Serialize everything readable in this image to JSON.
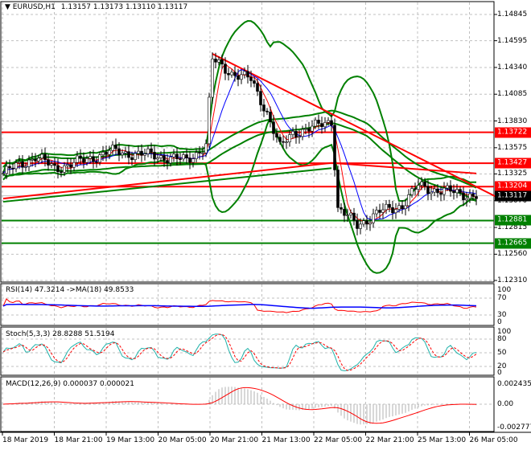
{
  "header": {
    "symbol": "EURUSD,H1",
    "ohlc": "1.13157 1.13173 1.13110 1.13117"
  },
  "main_axis": {
    "labels": [
      "1.14845",
      "1.14595",
      "1.14340",
      "1.14085",
      "1.13830",
      "1.13575",
      "1.13325",
      "1.13070",
      "1.12815",
      "1.12560",
      "1.12310"
    ],
    "max": 1.14845,
    "min": 1.1231
  },
  "levels": [
    {
      "price": 1.13722,
      "label": "1.13722",
      "color": "#ff0000"
    },
    {
      "price": 1.13427,
      "label": "1.13427",
      "color": "#ff0000"
    },
    {
      "price": 1.13204,
      "label": "1.13204",
      "color": "#ff0000"
    },
    {
      "price": 1.12881,
      "label": "1.12881",
      "color": "#008000"
    },
    {
      "price": 1.12665,
      "label": "1.12665",
      "color": "#008000"
    }
  ],
  "current_price": {
    "label": "1.13117",
    "price": 1.13117
  },
  "chart_data": {
    "type": "line",
    "bars": 148,
    "price_path": [
      [
        0,
        1.1333
      ],
      [
        10,
        1.1349
      ],
      [
        16,
        1.1338
      ],
      [
        25,
        1.1345
      ],
      [
        33,
        1.1354
      ],
      [
        50,
        1.1349
      ],
      [
        57,
        1.1345
      ],
      [
        63,
        1.136
      ],
      [
        65,
        1.1441
      ],
      [
        71,
        1.1429
      ],
      [
        77,
        1.1422
      ],
      [
        82,
        1.1391
      ],
      [
        86,
        1.1357
      ],
      [
        90,
        1.1372
      ],
      [
        96,
        1.1376
      ],
      [
        102,
        1.1384
      ],
      [
        104,
        1.1299
      ],
      [
        110,
        1.1284
      ],
      [
        117,
        1.1296
      ],
      [
        124,
        1.1303
      ],
      [
        129,
        1.1321
      ],
      [
        135,
        1.1317
      ],
      [
        147,
        1.13117
      ]
    ],
    "trendlines": [
      {
        "from": [
          65,
          1.1447
        ],
        "to": [
          153,
          1.1311
        ],
        "color": "#ff0000"
      },
      {
        "from": [
          0,
          1.1309
        ],
        "to": [
          102,
          1.1343
        ],
        "color": "#ff0000"
      },
      {
        "from": [
          102,
          1.1343
        ],
        "to": [
          147,
          1.1333
        ],
        "color": "#ff0000"
      },
      {
        "from": [
          0,
          1.1306
        ],
        "to": [
          102,
          1.1338
        ],
        "color": "#008000"
      }
    ]
  },
  "rsi": {
    "title": "RSI(14) 47.3214  ->MA(18) 49.8533",
    "labels": [
      "100",
      "70",
      "30",
      "0"
    ]
  },
  "stoch": {
    "title": "Stoch(5,3,3) 28.8288 51.5194",
    "labels": [
      "100",
      "80",
      "50",
      "20",
      "0"
    ]
  },
  "macd": {
    "title": "MACD(12,26,9) 0.000037 0.000021",
    "labels": [
      "0.002435",
      "0.00",
      "-0.002777"
    ]
  },
  "time_axis": [
    "18 Mar 2019",
    "18 Mar 21:00",
    "19 Mar 13:00",
    "20 Mar 05:00",
    "20 Mar 21:00",
    "21 Mar 13:00",
    "22 Mar 05:00",
    "22 Mar 21:00",
    "25 Mar 13:00",
    "26 Mar 05:00"
  ]
}
